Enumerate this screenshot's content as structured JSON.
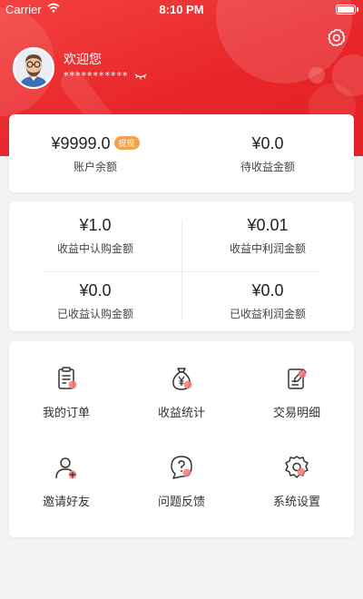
{
  "status_bar": {
    "carrier": "Carrier",
    "time": "8:10 PM"
  },
  "user": {
    "welcome": "欢迎您",
    "masked_account": "***********"
  },
  "balance": {
    "account_amount": "¥9999.0",
    "withdraw_badge": "提现",
    "account_label": "账户余额",
    "pending_amount": "¥0.0",
    "pending_label": "待收益金额"
  },
  "income": {
    "items": [
      {
        "amount": "¥1.0",
        "label": "收益中认购金额"
      },
      {
        "amount": "¥0.01",
        "label": "收益中利润金额"
      },
      {
        "amount": "¥0.0",
        "label": "已收益认购金额"
      },
      {
        "amount": "¥0.0",
        "label": "已收益利润金额"
      }
    ]
  },
  "menu": {
    "items": [
      {
        "label": "我的订单",
        "icon": "order-icon"
      },
      {
        "label": "收益统计",
        "icon": "money-bag-icon"
      },
      {
        "label": "交易明细",
        "icon": "transaction-detail-icon"
      },
      {
        "label": "邀请好友",
        "icon": "invite-friend-icon"
      },
      {
        "label": "问题反馈",
        "icon": "feedback-icon"
      },
      {
        "label": "系统设置",
        "icon": "settings-icon"
      }
    ]
  },
  "colors": {
    "brand_red": "#e8262a",
    "badge_orange": "#f5a04a",
    "icon_accent": "#f07a7a"
  }
}
